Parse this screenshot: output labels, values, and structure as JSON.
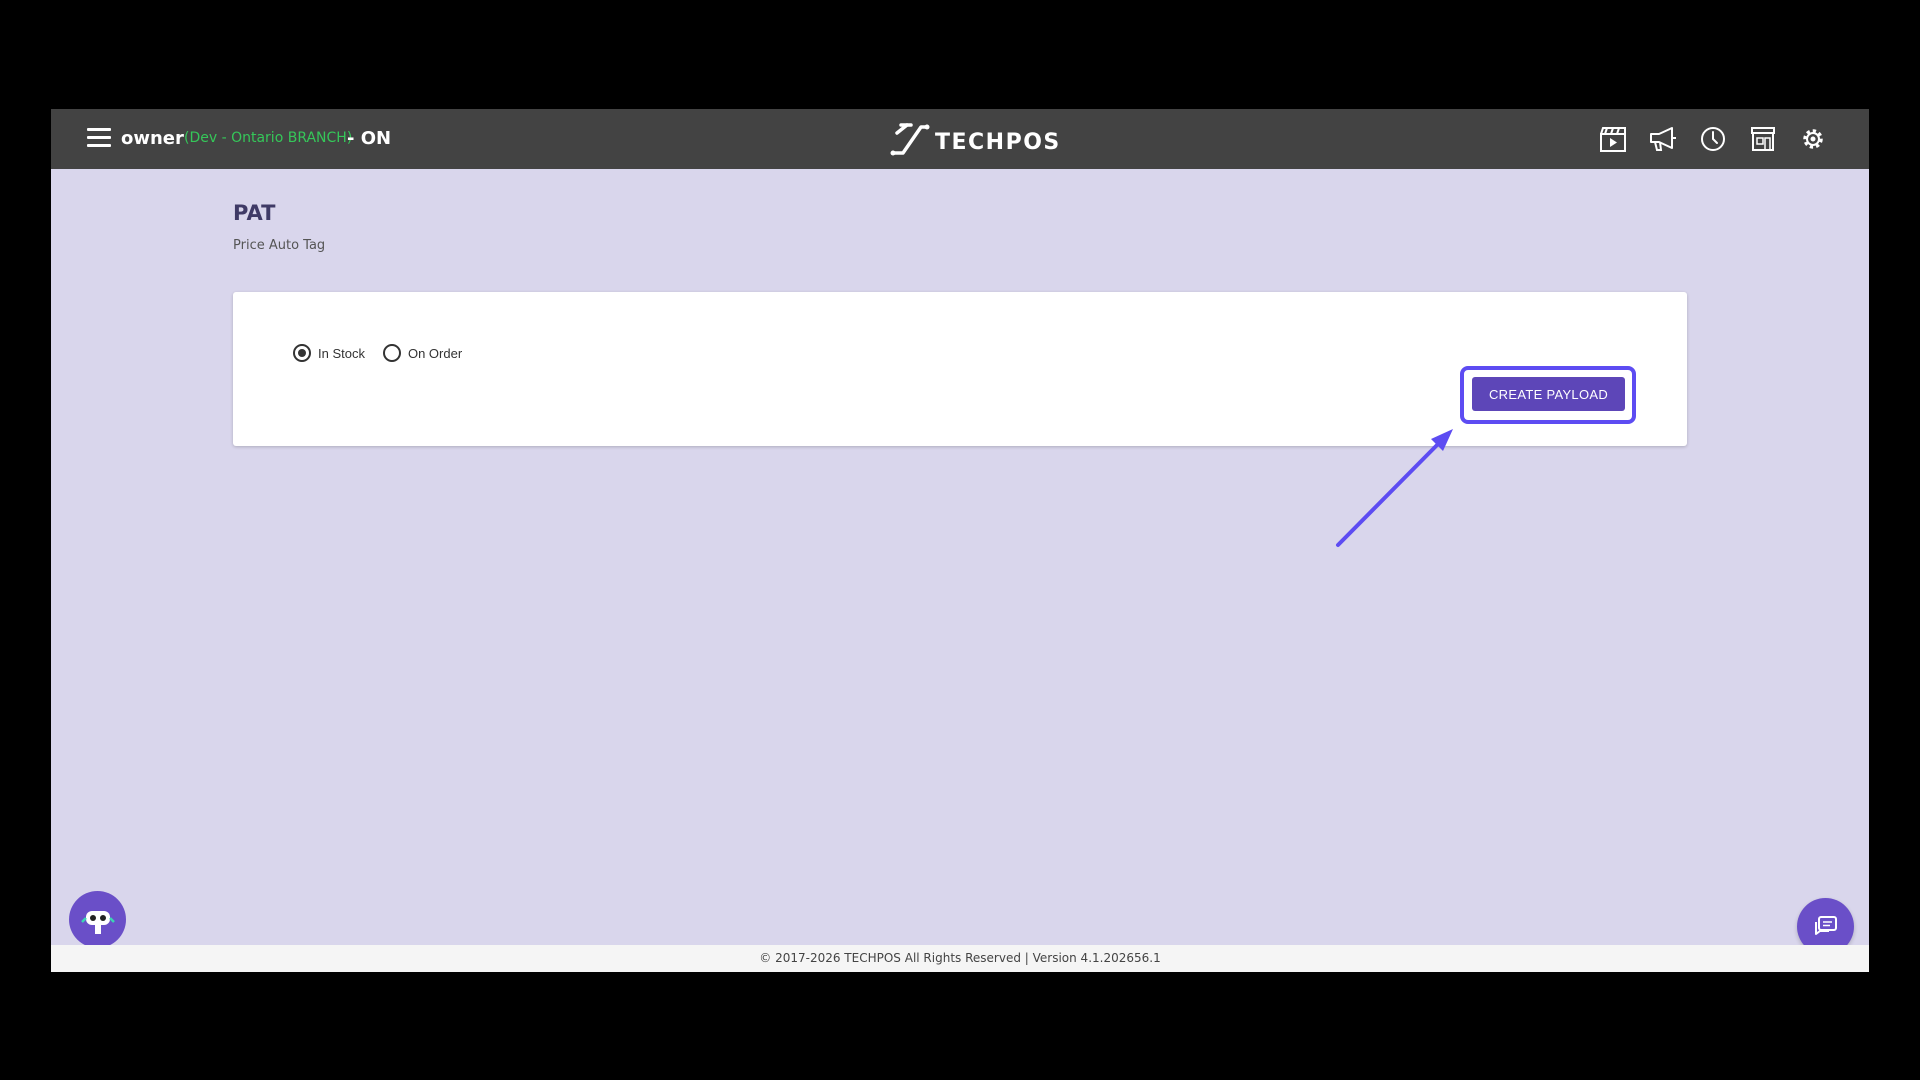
{
  "header": {
    "user": "owner",
    "branch": "(Dev - Ontario BRANCH)",
    "status": "- ON",
    "logo_text": "TECHPOS",
    "icons": [
      "video-tutorial-icon",
      "announcement-icon",
      "clock-icon",
      "store-icon",
      "gear-icon"
    ]
  },
  "page": {
    "title": "PAT",
    "subtitle": "Price Auto Tag"
  },
  "form": {
    "options": [
      {
        "label": "In Stock",
        "checked": true
      },
      {
        "label": "On Order",
        "checked": false
      }
    ],
    "create_label": "CREATE PAYLOAD"
  },
  "footer": {
    "text": "© 2017-2026 TECHPOS All Rights Reserved | Version 4.1.202656.1"
  },
  "colors": {
    "topbar": "#434343",
    "background": "#d9d6ec",
    "accent": "#5d46b8",
    "highlight": "#5d4cf2",
    "branch": "#35c759"
  }
}
